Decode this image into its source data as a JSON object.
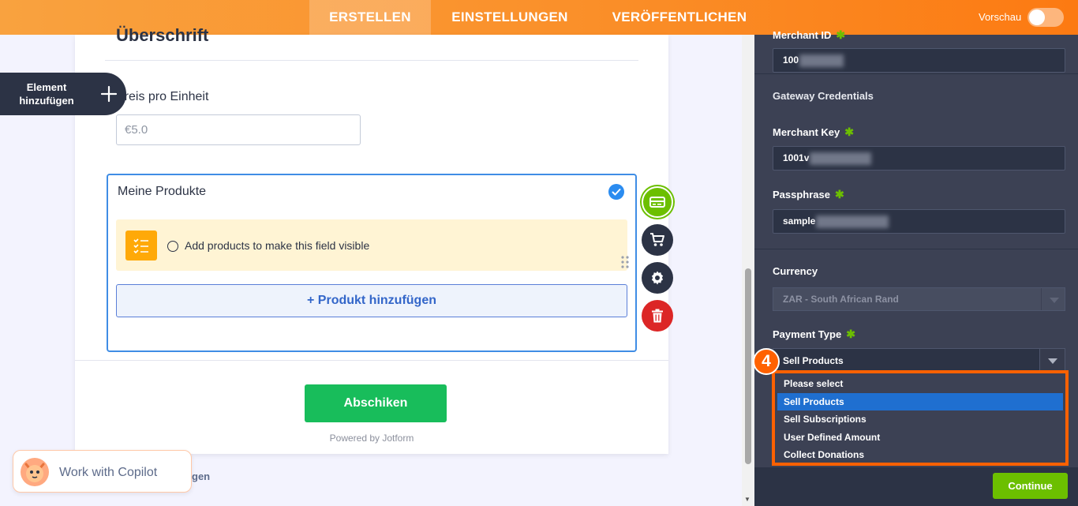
{
  "topbar": {
    "tabs": [
      {
        "label": "ERSTELLEN",
        "active": true
      },
      {
        "label": "EINSTELLUNGEN",
        "active": false
      },
      {
        "label": "VERÖFFENTLICHEN",
        "active": false
      }
    ],
    "preview_label": "Vorschau",
    "preview_enabled": false
  },
  "add_element": {
    "label": "Element hinzufügen",
    "icon": "plus-icon"
  },
  "form": {
    "heading": "Überschrift",
    "price_label": "Preis pro Einheit",
    "price_placeholder": "€5.0",
    "products_title": "Meine Produkte",
    "notice_text": "Add products to make this field visible",
    "add_product_label": "+ Produkt hinzufügen",
    "submit_label": "Abschiken",
    "powered_by": "Powered by Jotform"
  },
  "field_actions": [
    "payment-icon",
    "cart-icon",
    "gear-icon",
    "trash-icon"
  ],
  "copilot": {
    "label": "Work with Copilot",
    "behind_text": "gen"
  },
  "panel": {
    "merchant_id_label": "Merchant ID",
    "merchant_id_value": "100",
    "gateway_credentials": "Gateway Credentials",
    "merchant_key_label": "Merchant Key",
    "merchant_key_value": "1001v",
    "passphrase_label": "Passphrase",
    "passphrase_value": "sample",
    "currency_label": "Currency",
    "currency_value": "ZAR - South African Rand",
    "payment_type_label": "Payment Type",
    "payment_type_value": "Sell Products",
    "payment_type_options": [
      {
        "label": "Please select",
        "selected": false
      },
      {
        "label": "Sell Products",
        "selected": true
      },
      {
        "label": "Sell Subscriptions",
        "selected": false
      },
      {
        "label": "User Defined Amount",
        "selected": false
      },
      {
        "label": "Collect Donations",
        "selected": false
      }
    ],
    "step_badge": "4",
    "continue_label": "Continue"
  },
  "colors": {
    "accent_orange": "#ff6100",
    "green": "#6cbf00",
    "submit_green": "#18bd5b",
    "panel_bg": "#3c4154",
    "selection_blue": "#1f6fd0"
  }
}
